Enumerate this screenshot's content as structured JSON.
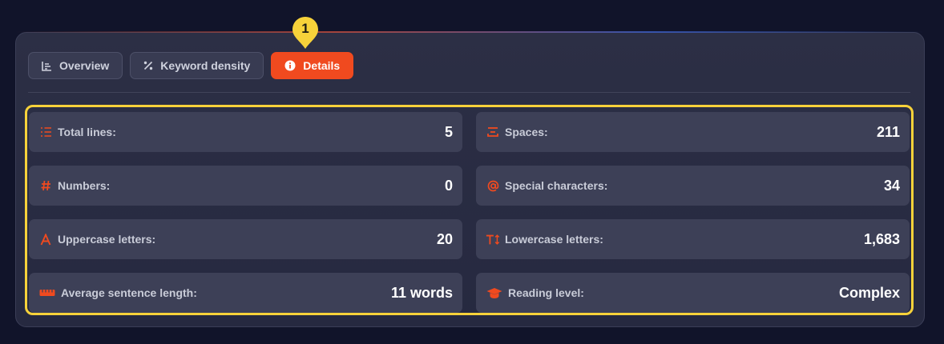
{
  "tabs": [
    {
      "label": "Overview",
      "icon": "chart-icon",
      "active": false
    },
    {
      "label": "Keyword density",
      "icon": "percent-icon",
      "active": false
    },
    {
      "label": "Details",
      "icon": "info-icon",
      "active": true
    }
  ],
  "badge": {
    "number": "1",
    "color": "#f7d23a"
  },
  "accent": "#f04a1f",
  "stats": {
    "total_lines": {
      "label": "Total lines:",
      "value": "5",
      "icon": "list-numbered-icon"
    },
    "spaces": {
      "label": "Spaces:",
      "value": "211",
      "icon": "space-icon"
    },
    "numbers": {
      "label": "Numbers:",
      "value": "0",
      "icon": "hash-icon"
    },
    "special_characters": {
      "label": "Special characters:",
      "value": "34",
      "icon": "at-icon"
    },
    "uppercase": {
      "label": "Uppercase letters:",
      "value": "20",
      "icon": "letter-a-icon"
    },
    "lowercase": {
      "label": "Lowercase letters:",
      "value": "1,683",
      "icon": "text-height-icon"
    },
    "avg_sentence": {
      "label": "Average sentence length:",
      "value": "11 words",
      "icon": "ruler-icon"
    },
    "reading_level": {
      "label": "Reading level:",
      "value": "Complex",
      "icon": "graduation-cap-icon"
    }
  }
}
